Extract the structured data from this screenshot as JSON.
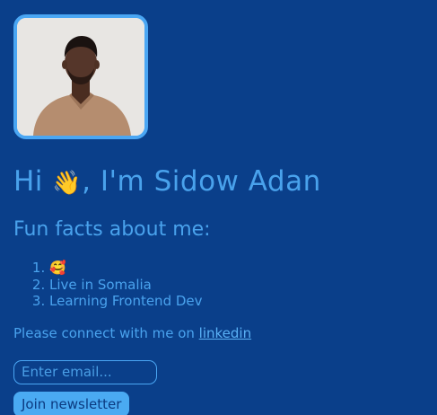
{
  "profile": {
    "photo_alt": "Profile photo of Sidow Adan",
    "greeting_prefix": "Hi",
    "wave_emoji": "👋",
    "greeting_suffix": ", I'm Sidow Adan"
  },
  "facts": {
    "title": "Fun facts about me:",
    "items": [
      "🥰",
      "Live in Somalia",
      "Learning Frontend Dev"
    ]
  },
  "connect": {
    "text": "Please connect with me on ",
    "link_label": "linkedin"
  },
  "newsletter": {
    "email_placeholder": "Enter email...",
    "email_value": "",
    "join_label": "Join newsletter"
  },
  "colors": {
    "background": "#0a3f8a",
    "accent": "#4aa3ee",
    "button_bg": "#4aaaf2",
    "button_text": "#0b3a80"
  }
}
